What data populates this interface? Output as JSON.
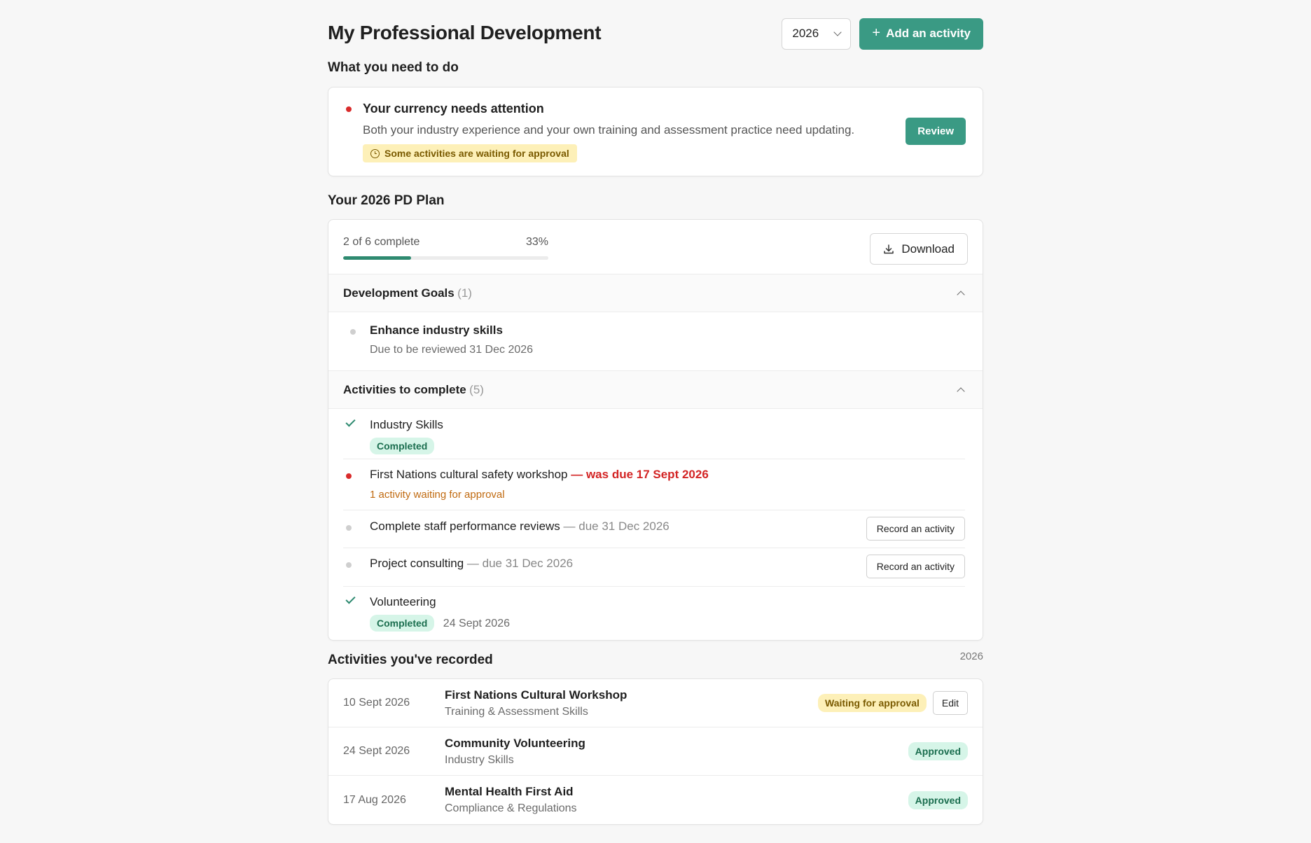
{
  "header": {
    "title": "My Professional Development",
    "year_selected": "2026",
    "add_button_label": "Add an activity"
  },
  "todo": {
    "section_title": "What you need to do",
    "alert_title": "Your currency needs attention",
    "alert_desc": "Both your industry experience and your own training and assessment practice need updating.",
    "warning_badge": "Some activities are waiting for approval",
    "review_label": "Review"
  },
  "plan": {
    "section_title": "Your 2026 PD Plan",
    "progress_label": "2 of 6 complete",
    "progress_percent_label": "33%",
    "progress_value": 0.33,
    "download_label": "Download",
    "goals_header": "Development Goals",
    "goals_count": "(1)",
    "goals": [
      {
        "name": "Enhance industry skills",
        "sub": "Due to be reviewed 31 Dec 2026"
      }
    ],
    "activities_header": "Activities to complete",
    "activities_count": "(5)",
    "activities": [
      {
        "name": "Industry Skills",
        "badge": "Completed"
      },
      {
        "name": "First Nations cultural safety workshop",
        "overdue": "— was due 17 Sept 2026",
        "waiting": "1 activity waiting for approval"
      },
      {
        "name": "Complete staff performance reviews",
        "due": " — due 31 Dec 2026",
        "action": "Record an activity"
      },
      {
        "name": "Project consulting",
        "due": " — due 31 Dec 2026",
        "action": "Record an activity"
      },
      {
        "name": "Volunteering",
        "badge": "Completed",
        "date": "24 Sept 2026"
      }
    ]
  },
  "recorded": {
    "section_title": "Activities you've recorded",
    "year": "2026",
    "rows": [
      {
        "date": "10 Sept 2026",
        "title": "First Nations Cultural Workshop",
        "category": "Training & Assessment Skills",
        "status": "Waiting for approval",
        "edit_label": "Edit"
      },
      {
        "date": "24 Sept 2026",
        "title": "Community Volunteering",
        "category": "Industry Skills",
        "status": "Approved"
      },
      {
        "date": "17 Aug 2026",
        "title": "Mental Health First Aid",
        "category": "Compliance & Regulations",
        "status": "Approved"
      }
    ]
  },
  "colors": {
    "accent": "#3a9a84",
    "progress_fill": "#2e8a70",
    "danger": "#d32424",
    "warning_bg": "#fdf0b8",
    "success_bg": "#d6f5e8"
  }
}
